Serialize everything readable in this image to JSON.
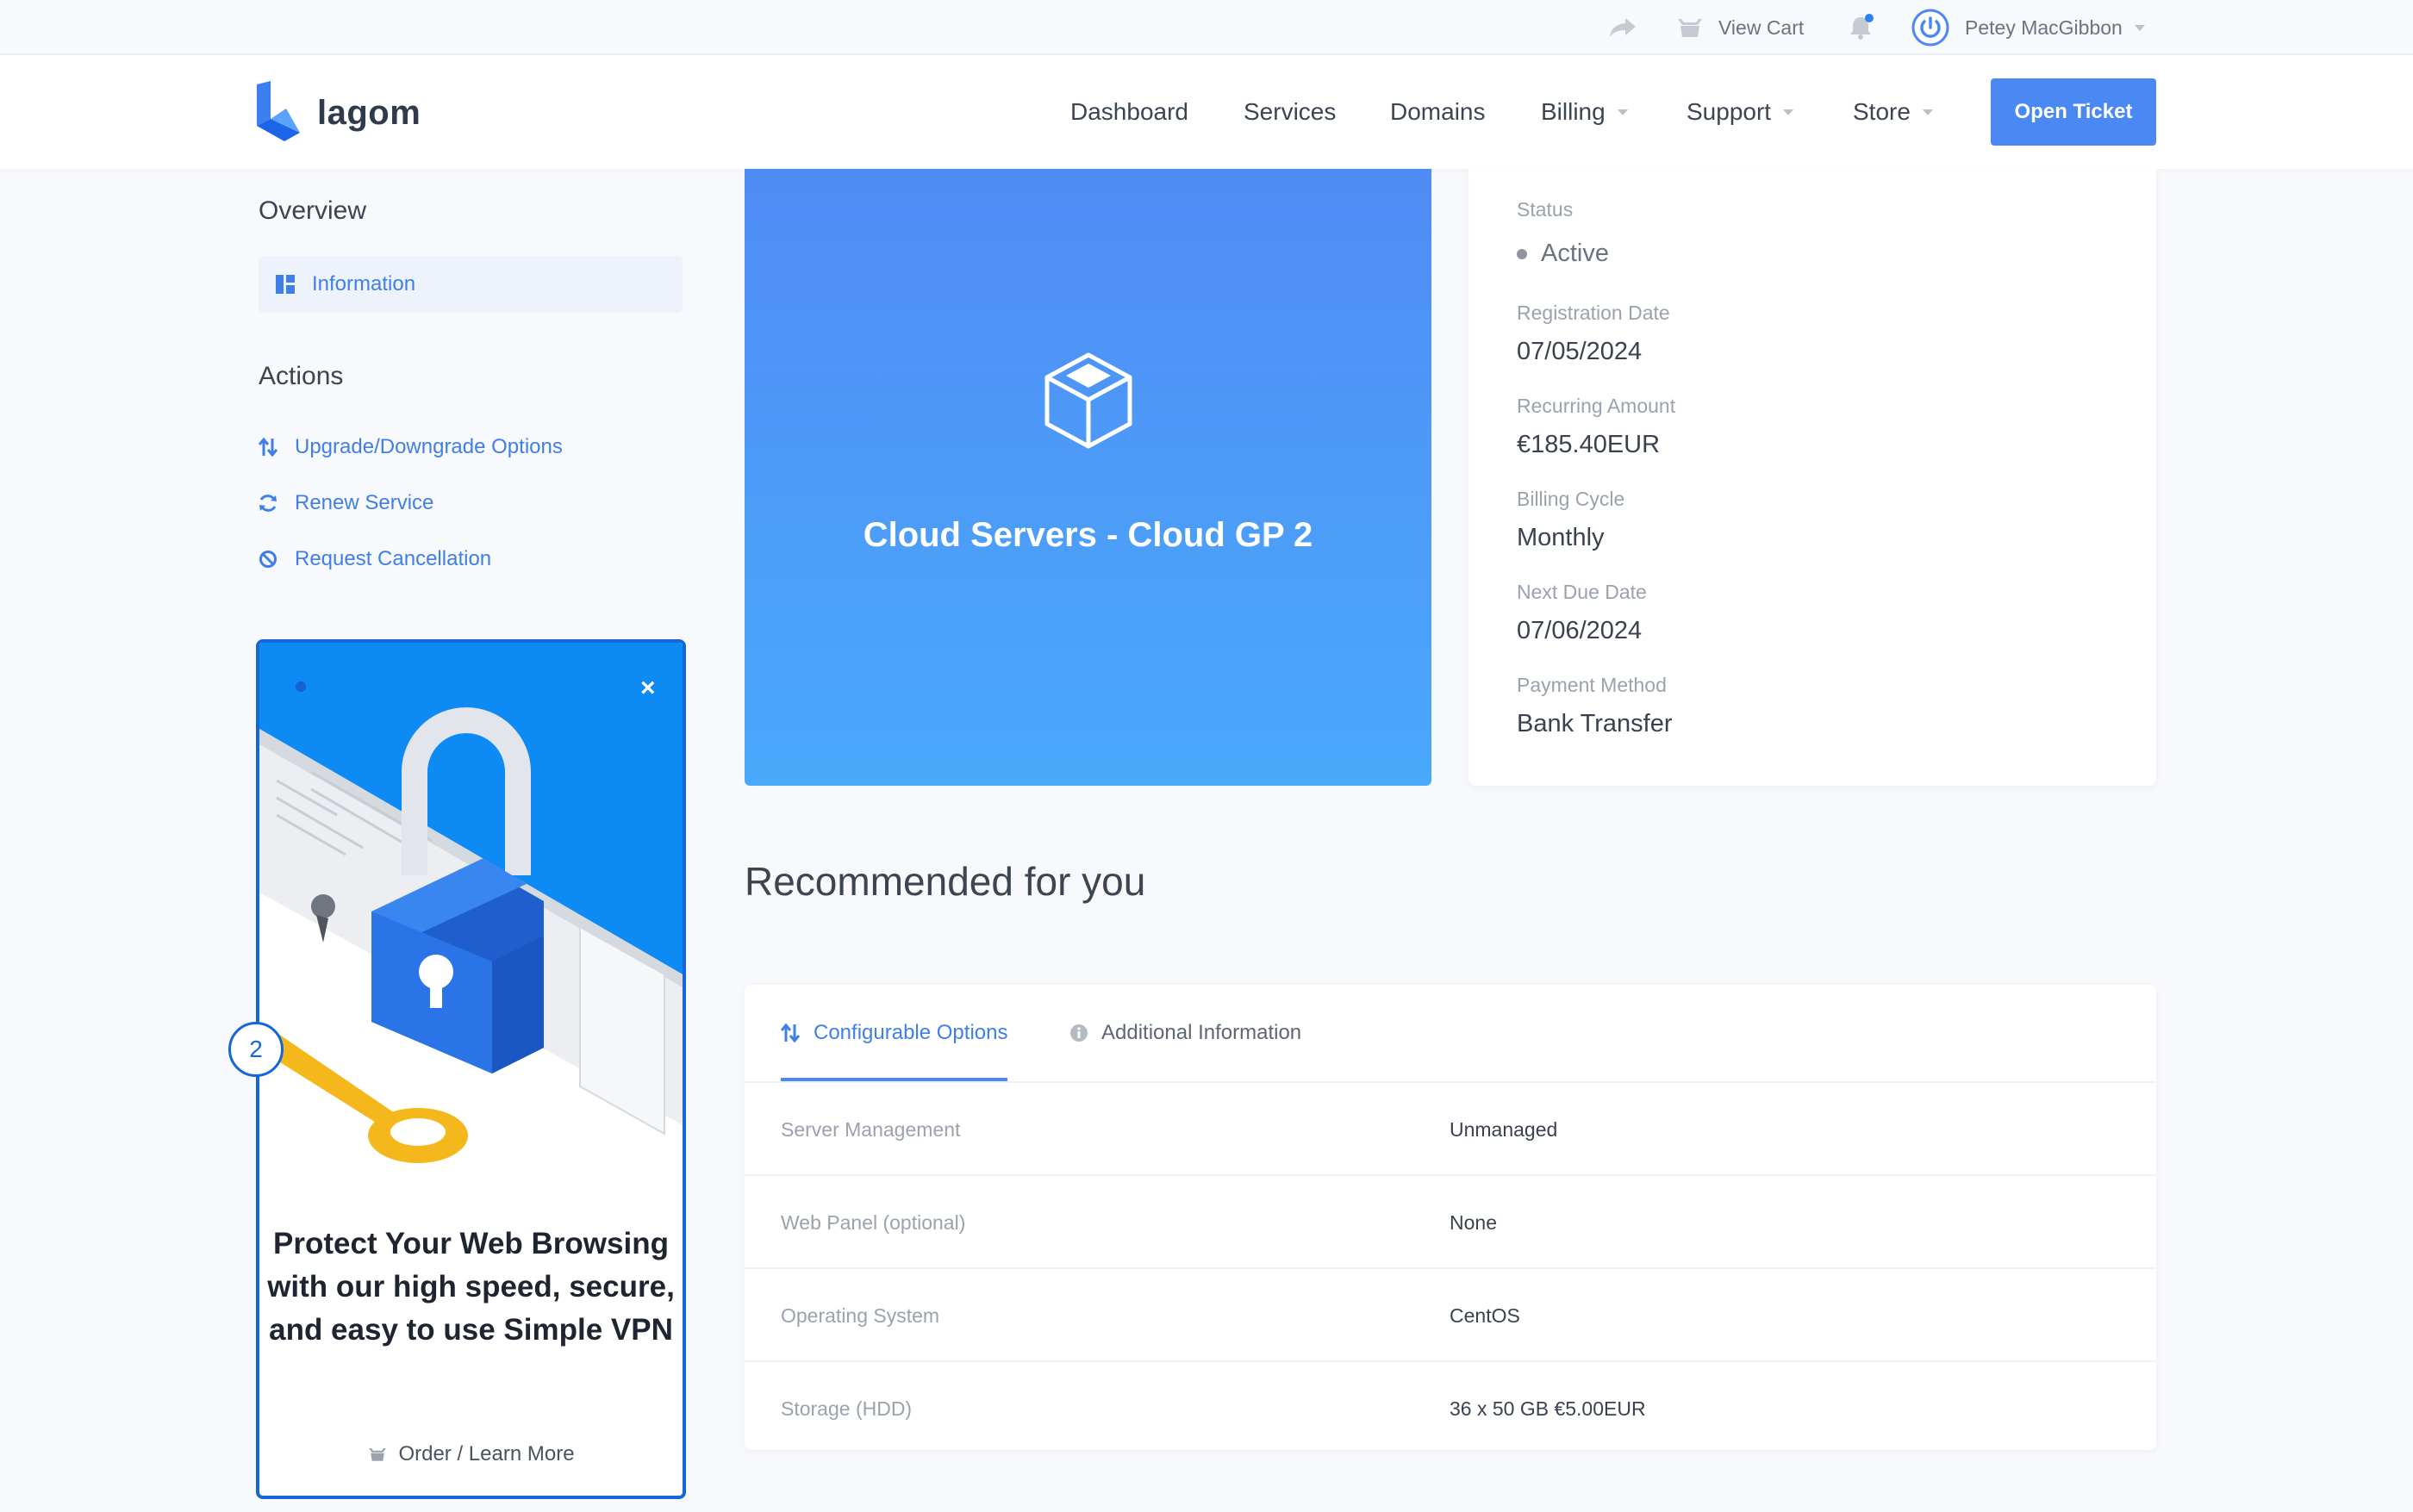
{
  "topbar": {
    "view_cart": "View Cart",
    "user_name": "Petey MacGibbon"
  },
  "header": {
    "logo_text": "lagom",
    "nav": [
      "Dashboard",
      "Services",
      "Domains",
      "Billing",
      "Support",
      "Store"
    ],
    "open_ticket": "Open Ticket"
  },
  "sidebar": {
    "overview_title": "Overview",
    "information": "Information",
    "actions_title": "Actions",
    "actions": [
      "Upgrade/Downgrade Options",
      "Renew Service",
      "Request Cancellation"
    ]
  },
  "promo": {
    "close": "×",
    "title": "Protect Your Web Browsing with our high speed, secure, and easy to use Simple VPN",
    "link": "Order / Learn More",
    "badge": "2"
  },
  "product": {
    "name": "Cloud Servers - Cloud GP 2"
  },
  "details": {
    "status_label": "Status",
    "status_value": "Active",
    "registration_label": "Registration Date",
    "registration_value": "07/05/2024",
    "recurring_label": "Recurring Amount",
    "recurring_value": "€185.40EUR",
    "cycle_label": "Billing Cycle",
    "cycle_value": "Monthly",
    "due_label": "Next Due Date",
    "due_value": "07/06/2024",
    "payment_label": "Payment Method",
    "payment_value": "Bank Transfer"
  },
  "recommended": {
    "title": "Recommended for you"
  },
  "options": {
    "tabs": [
      "Configurable Options",
      "Additional Information"
    ],
    "rows": [
      {
        "key": "Server Management",
        "value": "Unmanaged"
      },
      {
        "key": "Web Panel (optional)",
        "value": "None"
      },
      {
        "key": "Operating System",
        "value": "CentOS"
      },
      {
        "key": "Storage (HDD)",
        "value": "36 x 50 GB €5.00EUR"
      }
    ]
  },
  "colors": {
    "accent": "#4a89f3",
    "link": "#3f7fe6",
    "promo_border": "#1566d9",
    "status_dot": "#8e959f"
  },
  "icons": [
    "share-icon",
    "cart-icon",
    "bell-icon",
    "power-icon",
    "dashboard-icon",
    "upgrade-icon",
    "renew-icon",
    "cancel-icon",
    "cube-icon",
    "info-icon"
  ]
}
